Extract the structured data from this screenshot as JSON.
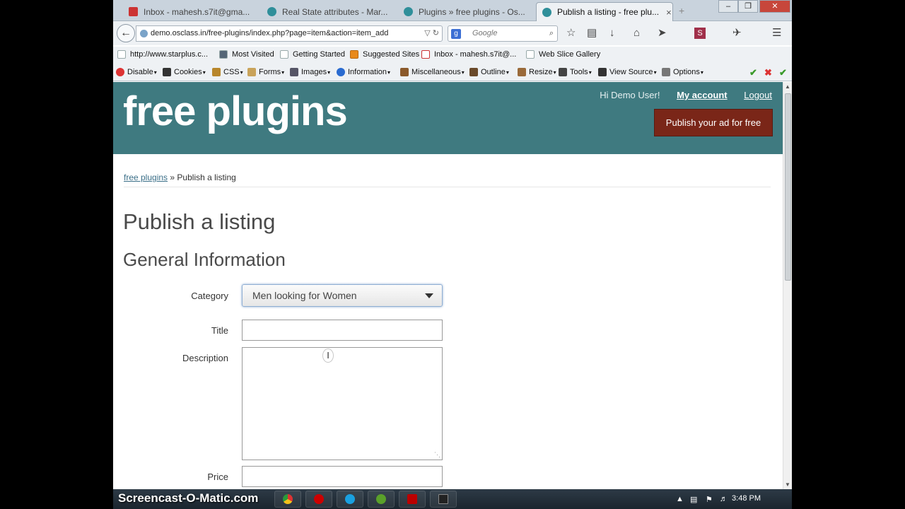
{
  "browser": {
    "tabs": [
      {
        "label": "Inbox - mahesh.s7it@gma...",
        "icon": "gmail-icon",
        "color": "#c33"
      },
      {
        "label": "Real State attributes - Mar...",
        "icon": "osclass-icon",
        "color": "#2f8f9a"
      },
      {
        "label": "Plugins » free plugins - Os...",
        "icon": "osclass-icon",
        "color": "#2f8f9a"
      },
      {
        "label": "Publish a listing - free plu...",
        "icon": "osclass-icon",
        "color": "#2f8f9a",
        "close": "×"
      }
    ],
    "window_controls": {
      "minimize": "–",
      "maximize": "❐",
      "close": "✕"
    },
    "new_tab": "+",
    "url": "demo.osclass.in/free-plugins/index.php?page=item&action=item_add",
    "url_buttons": "▽ ↻",
    "search_placeholder": "Google",
    "search_badge": "g",
    "search_icon": "⌕",
    "bookmarks": [
      "http://www.starplus.c...",
      "Most Visited",
      "Getting Started",
      "Suggested Sites",
      "Inbox - mahesh.s7it@...",
      "Web Slice Gallery"
    ],
    "devtools": [
      "Disable",
      "Cookies",
      "CSS",
      "Forms",
      "Images",
      "Information",
      "Miscellaneous",
      "Outline",
      "Resize",
      "Tools",
      "View Source",
      "Options"
    ],
    "checks": [
      "✔",
      "✖",
      "✔"
    ]
  },
  "site": {
    "logo": "free plugins",
    "greeting": "Hi Demo User!",
    "my_account": "My account",
    "logout": "Logout",
    "publish_button": "Publish your ad for free",
    "breadcrumb_home": "free plugins",
    "breadcrumb_sep": "»",
    "breadcrumb_current": "Publish a listing",
    "page_title": "Publish a listing",
    "section_title": "General Information",
    "form": {
      "category_label": "Category",
      "category_value": "Men looking for Women",
      "title_label": "Title",
      "title_value": "",
      "description_label": "Description",
      "description_value": "",
      "price_label": "Price",
      "price_value": ""
    }
  },
  "taskbar": {
    "watermark": "Screencast-O-Matic.com",
    "time": "3:48 PM",
    "tray": "▲"
  },
  "colors": {
    "header_bg": "#3f7a80",
    "publish_btn": "#7a2618",
    "link": "#3b6f88"
  }
}
